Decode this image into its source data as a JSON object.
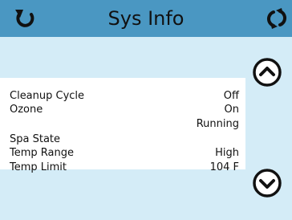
{
  "header": {
    "title": "Sys Info",
    "back_icon": "back-arrow-icon",
    "refresh_icon": "refresh-icon"
  },
  "info_rows": [
    {
      "label": "Cleanup Cycle",
      "value": "Off"
    },
    {
      "label": "Ozone",
      "value": "On"
    },
    {
      "label": "",
      "value": "Running"
    },
    {
      "label": "Spa State",
      "value": ""
    },
    {
      "label": "Temp Range",
      "value": "High"
    },
    {
      "label": "Temp Limit",
      "value": "104 F"
    }
  ],
  "scroll": {
    "up_icon": "chevron-up-icon",
    "down_icon": "chevron-down-icon"
  },
  "colors": {
    "header": "#4a97c2",
    "background": "#d4ecf7",
    "panel": "#ffffff",
    "text": "#111111"
  }
}
